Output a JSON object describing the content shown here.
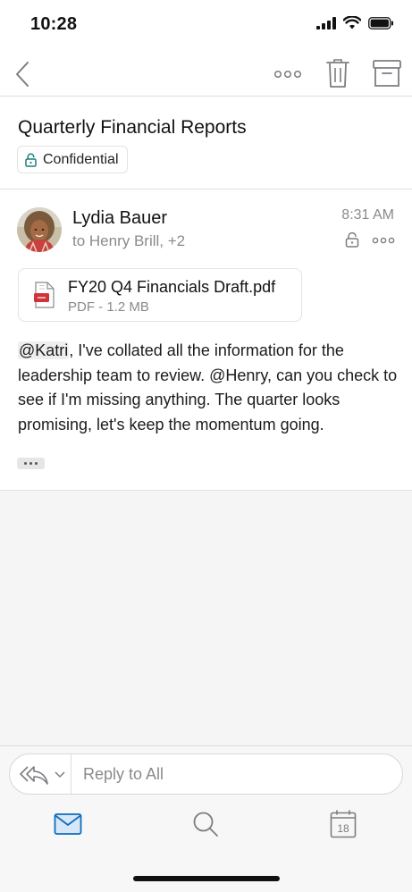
{
  "status_bar": {
    "time": "10:28",
    "icons": [
      "cellular-signal-icon",
      "wifi-icon",
      "battery-icon"
    ]
  },
  "nav": {
    "icons": [
      "back-chevron-icon",
      "more-dots-icon",
      "trash-icon",
      "archive-icon"
    ]
  },
  "email": {
    "subject": "Quarterly Financial Reports",
    "sensitivity_label": "Confidential",
    "sender": "Lydia Bauer",
    "recipients": "to Henry Brill, +2",
    "time": "8:31 AM",
    "attachment": {
      "name": "FY20 Q4 Financials Draft.pdf",
      "meta": "PDF - 1.2 MB"
    },
    "body": {
      "mention_1": "@Katri",
      "text_1": ", I've collated all the information for the leadership team to review. @Henry, can you check to see if I'm missing anything. The quarter looks promising, let's keep the momentum going."
    }
  },
  "reply": {
    "placeholder": "Reply to All"
  },
  "tab_bar": {
    "calendar_day": "18",
    "tabs": [
      "mail-icon",
      "search-icon",
      "calendar-icon"
    ]
  },
  "colors": {
    "accent": "#0f6cbd",
    "icon_gray": "#8a8a8e",
    "teal_lock": "#1a7f7a",
    "pdf_red": "#d13438"
  }
}
